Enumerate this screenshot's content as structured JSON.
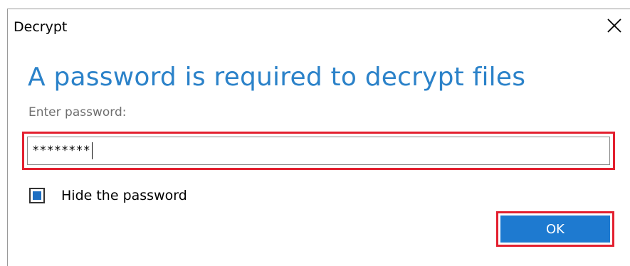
{
  "dialog": {
    "title": "Decrypt",
    "close_icon": "close-icon",
    "heading": "A password is required to decrypt files",
    "password_label": "Enter password:",
    "password_value": "********",
    "hide_password": {
      "label": "Hide the password",
      "checked": true
    },
    "ok_label": "OK",
    "colors": {
      "heading": "#2b82c9",
      "ok_button": "#1e7ad0",
      "highlight": "#e3202f",
      "checkbox_fill": "#1e6fc2"
    }
  }
}
